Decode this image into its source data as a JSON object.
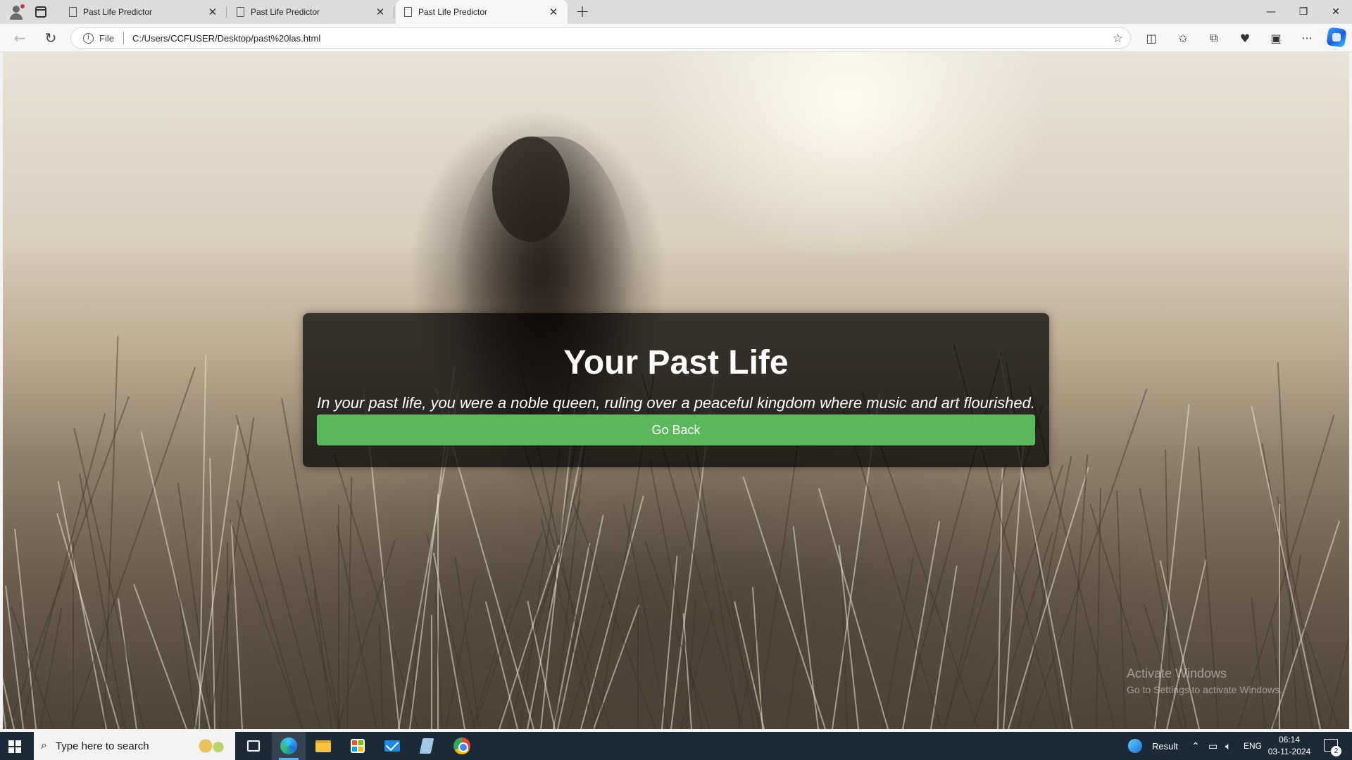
{
  "browser": {
    "tabs": [
      {
        "title": "Past Life Predictor",
        "active": false
      },
      {
        "title": "Past Life Predictor",
        "active": false
      },
      {
        "title": "Past Life Predictor",
        "active": true
      }
    ],
    "address": {
      "protocol_label": "File",
      "url": "C:/Users/CCFUSER/Desktop/past%20las.html"
    },
    "window_controls": {
      "minimize": "—",
      "restore": "❐",
      "close": "✕"
    }
  },
  "page": {
    "title": "Your Past Life",
    "result_text": "In your past life, you were a noble queen, ruling over a peaceful kingdom where music and art flourished.",
    "button_label": "Go Back",
    "colors": {
      "button": "#5cb85c",
      "card": "rgba(0,0,0,0.72)",
      "text": "#ffffff"
    }
  },
  "watermark": {
    "line1": "Activate Windows",
    "line2": "Go to Settings to activate Windows."
  },
  "taskbar": {
    "search_placeholder": "Type here to search",
    "apps": [
      "task-view",
      "edge",
      "file-explorer",
      "microsoft-store",
      "mail",
      "notepad",
      "chrome"
    ],
    "weather_label": "Result",
    "language": "ENG",
    "time": "06:14",
    "date": "03-11-2024",
    "notification_count": "2"
  }
}
